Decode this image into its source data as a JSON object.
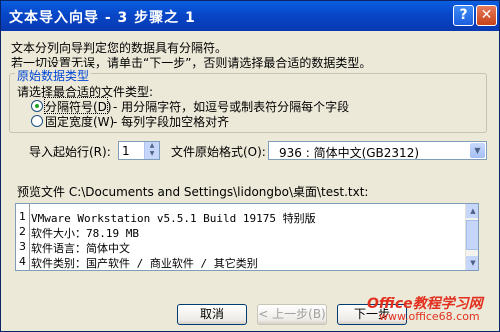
{
  "window": {
    "title": "文本导入向导 - 3 步骤之 1",
    "help_label": "?",
    "close_label": "✕"
  },
  "intro": {
    "line1": "文本分列向导判定您的数据具有分隔符。",
    "line2": "若一切设置无误，请单击“下一步”，否则请选择最合适的数据类型。"
  },
  "group": {
    "label": "原始数据类型",
    "prompt": "请选择最合适的文件类型:",
    "options": [
      {
        "label": "分隔符号(D)",
        "desc": "- 用分隔字符，如逗号或制表符分隔每个字段",
        "selected": true
      },
      {
        "label": "固定宽度(W)",
        "desc": "- 每列字段加空格对齐",
        "selected": false
      }
    ]
  },
  "import_start": {
    "label": "导入起始行(R):",
    "value": "1"
  },
  "file_origin": {
    "label": "文件原始格式(O):",
    "value": "936 : 简体中文(GB2312)"
  },
  "preview": {
    "label": "预览文件 C:\\Documents and Settings\\lidongbo\\桌面\\test.txt:",
    "rows": [
      {
        "num": "1",
        "text": "VMware Workstation v5.5.1 Build 19175 特别版"
      },
      {
        "num": "2",
        "text": "软件大小：78.19 MB"
      },
      {
        "num": "3",
        "text": "软件语言：简体中文"
      },
      {
        "num": "4",
        "text": "软件类别：国产软件 / 商业软件 / 其它类别"
      }
    ]
  },
  "buttons": {
    "cancel": "取消",
    "back": "< 上一步(B)",
    "next": "下一步"
  },
  "watermark": {
    "line1": "Office教程学习网",
    "line2": "www.office68.com"
  },
  "colors": {
    "titlebar": "#0846c8",
    "group_label": "#0046d5",
    "watermark": "#e2301f"
  }
}
